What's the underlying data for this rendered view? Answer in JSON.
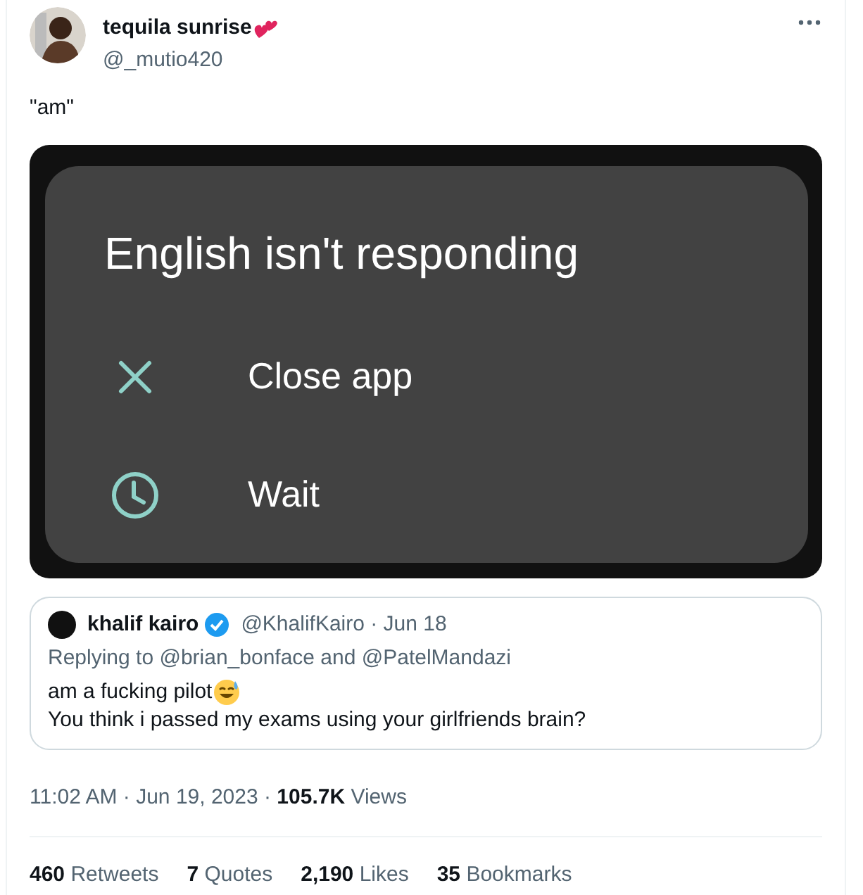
{
  "author": {
    "name": "tequila sunrise",
    "handle": "@_mutio420"
  },
  "text": "\"am\"",
  "media": {
    "dialog": {
      "title": "English isn't responding",
      "options": [
        {
          "kind": "close",
          "label": "Close app"
        },
        {
          "kind": "wait",
          "label": "Wait"
        }
      ]
    }
  },
  "quote": {
    "name": "khalif kairo",
    "verified": true,
    "meta": "@KhalifKairo · Jun 18",
    "replying": "Replying to @brian_bonface and @PatelMandazi",
    "lines": [
      "am a fucking pilot",
      "You think i passed my exams using your girlfriends brain?"
    ]
  },
  "timestamp": "11:02 AM · Jun 19, 2023 · **105.7K** Views",
  "stats": [
    "**460** Retweets",
    "**7** Quotes",
    "**2,190** Likes",
    "**35** Bookmarks"
  ]
}
